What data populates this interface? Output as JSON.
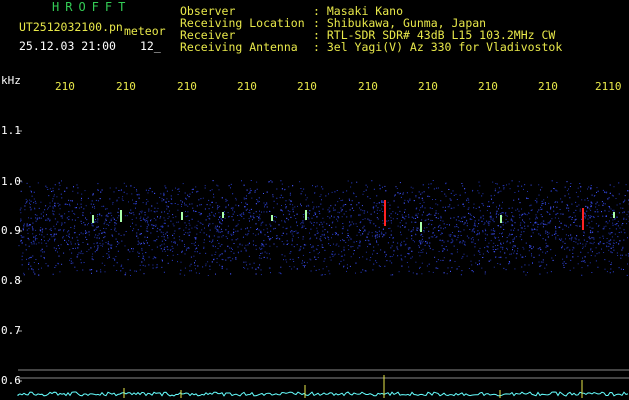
{
  "header": {
    "brand": "HROFFT",
    "file_name": "UT2512032100.pn",
    "file_suffix": "meteor",
    "date_time": "25.12.03 21:00",
    "frame_no": "12_",
    "info": [
      {
        "label": "Observer",
        "value": ": Masaki Kano"
      },
      {
        "label": "Receiving Location",
        "value": ": Shibukawa, Gunma, Japan"
      },
      {
        "label": "Receiver",
        "value": ": RTL-SDR SDR# 43dB L15 103.2MHz CW"
      },
      {
        "label": "Receiving Antenna",
        "value": ": 3el Yagi(V) Az 330 for Vladivostok"
      }
    ]
  },
  "spectrogram": {
    "unit_label": "kHz",
    "time_ticks": [
      "210",
      "210",
      "210",
      "210",
      "210",
      "210",
      "210",
      "210",
      "210",
      "2110"
    ],
    "freq_ticks": [
      "1.1",
      "1.0",
      "0.9",
      "0.8",
      "0.7",
      "0.6"
    ],
    "colors": {
      "noise": "#2233aa",
      "noise_bright": "#4455ff",
      "echo": "#ff2222",
      "trace": "#66ffff",
      "grid": "#888888"
    }
  }
}
